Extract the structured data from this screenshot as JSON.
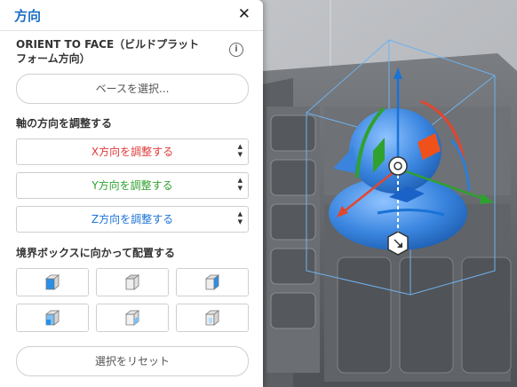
{
  "panel": {
    "title": "方向",
    "close_glyph": "✕",
    "orient_title": "ORIENT TO FACE（ビルドプラットフォーム方向）",
    "orient_title_line1": "ORIENT TO FACE（ビルドプラット",
    "orient_title_line2": "フォーム方向）",
    "info_glyph": "i",
    "select_base_label": "ベースを選択...",
    "adjust_title": "軸の方向を調整する",
    "axes": [
      {
        "label": "X方向を調整する",
        "color": "#e03a3a"
      },
      {
        "label": "Y方向を調整する",
        "color": "#2fa12f"
      },
      {
        "label": "Z方向を調整する",
        "color": "#1a73d6"
      }
    ],
    "spinner_up": "▲",
    "spinner_down": "▼",
    "bbox_title": "境界ボックスに向かって配置する",
    "reset_label": "選択をリセット"
  },
  "colors": {
    "accent": "#1a6fc4",
    "face_highlight": "#2a8fe6",
    "model": "#3b86e0"
  },
  "icons": [
    "close-icon",
    "info-icon",
    "cube-face-icon",
    "rotate-handle-icon",
    "move-handle-icon"
  ]
}
